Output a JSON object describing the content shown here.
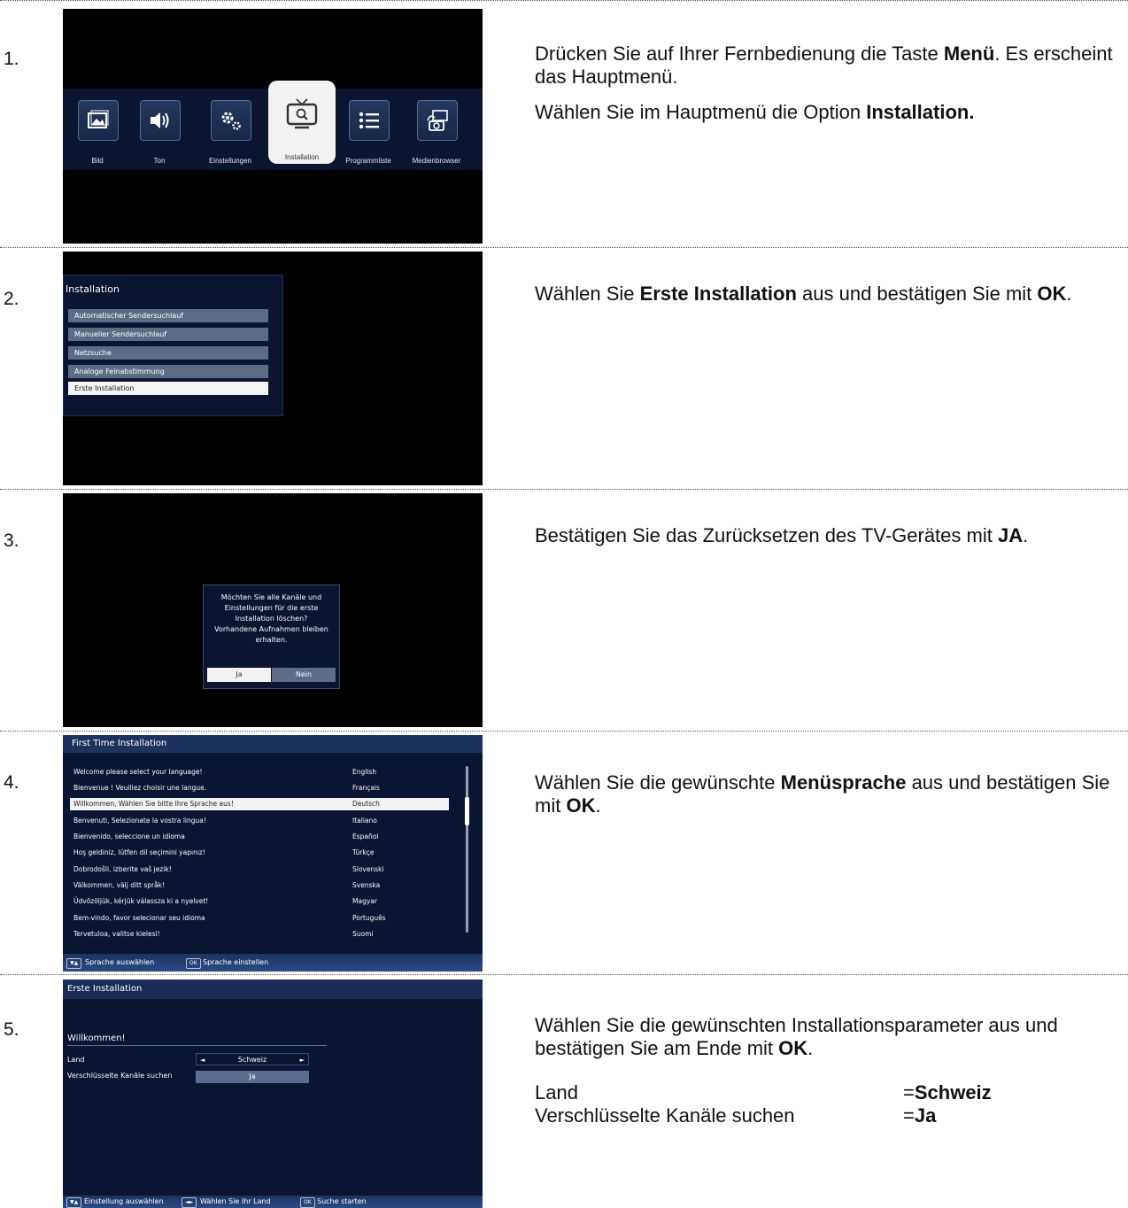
{
  "steps": [
    {
      "number": "1.",
      "menu_items": [
        "Bild",
        "Ton",
        "Einstellungen",
        "Installation",
        "Programmliste",
        "Medienbrowser"
      ],
      "selected_item": "Installation",
      "text_parts": [
        "Drücken Sie auf Ihrer Fernbedienung die Taste ",
        "Menü",
        ". Es erscheint das Hauptmenü.",
        "Wählen Sie im Hauptmenü die Option ",
        "Installation."
      ]
    },
    {
      "number": "2.",
      "menu_title": "Installation",
      "menu_items": [
        "Automatischer Sendersuchlauf",
        "Manueller Sendersuchlauf",
        "Netzsuche",
        "Analoge Feinabstimmung",
        "Erste Installation"
      ],
      "selected_item": "Erste Installation",
      "text_parts": [
        "Wählen Sie ",
        "Erste Installation",
        " aus und bestätigen Sie mit ",
        "OK",
        "."
      ]
    },
    {
      "number": "3.",
      "dialog_text": "Möchten Sie alle Kanäle und\nEinstellungen für die erste\nInstallation löschen?\nVorhandene Aufnahmen bleiben\nerhalten.",
      "yes_label": "Ja",
      "no_label": "Nein",
      "text_parts": [
        "Bestätigen Sie das Zurücksetzen des TV-Gerätes mit ",
        "JA",
        "."
      ]
    },
    {
      "number": "4.",
      "screen_title": "First Time Installation",
      "languages": [
        {
          "prompt": "Welcome please select your language!",
          "name": "English"
        },
        {
          "prompt": "Bienvenue ! Veuillez choisir une langue.",
          "name": "Français"
        },
        {
          "prompt": "Willkommen, Wählen Sie bitte Ihre Sprache aus!",
          "name": "Deutsch"
        },
        {
          "prompt": "Benvenuti, Selezionate la vostra lingua!",
          "name": "Italiano"
        },
        {
          "prompt": "Bienvenido, seleccione un idioma",
          "name": "Español"
        },
        {
          "prompt": "Hoş geldiniz, lütfen dil seçimini yapınız!",
          "name": "Türkçe"
        },
        {
          "prompt": "Dobrodošli, izberite vaš jezik!",
          "name": "Slovenski"
        },
        {
          "prompt": "Välkommen, välj ditt språk!",
          "name": "Svenska"
        },
        {
          "prompt": "Üdvözöljük, kérjük válassza ki a nyelvet!",
          "name": "Magyar"
        },
        {
          "prompt": "Bem-vindo, favor selecionar seu idioma",
          "name": "Português"
        },
        {
          "prompt": "Tervetuloa, valitse kielesi!",
          "name": "Suomi"
        }
      ],
      "selected_language": "Deutsch",
      "footer": {
        "key1": "▼▲",
        "hint1": "Sprache auswählen",
        "key2": "OK",
        "hint2": "Sprache einstellen"
      },
      "text_parts": [
        "Wählen Sie die gewünschte ",
        "Menüsprache",
        " aus und bestätigen Sie mit ",
        "OK",
        "."
      ]
    },
    {
      "number": "5.",
      "screen_title": "Erste Installation",
      "welcome": "Willkommen!",
      "settings": [
        {
          "label": "Land",
          "value": "Schweiz"
        },
        {
          "label": "Verschlüsselte Kanäle suchen",
          "value": "Ja"
        }
      ],
      "footer": {
        "key1": "▼▲",
        "hint1": "Einstellung auswählen",
        "key2": "◄►",
        "hint2": "Wählen Sie Ihr Land",
        "key3": "OK",
        "hint3": "Suche starten"
      },
      "text_parts": [
        "Wählen Sie die gewünschten Installationsparameter aus und bestätigen Sie am Ende mit ",
        "OK",
        "."
      ],
      "params": [
        {
          "label": "Land",
          "value": "Schweiz"
        },
        {
          "label": "Verschlüsselte Kanäle suchen",
          "value": "Ja"
        }
      ],
      "eq": "= "
    }
  ]
}
